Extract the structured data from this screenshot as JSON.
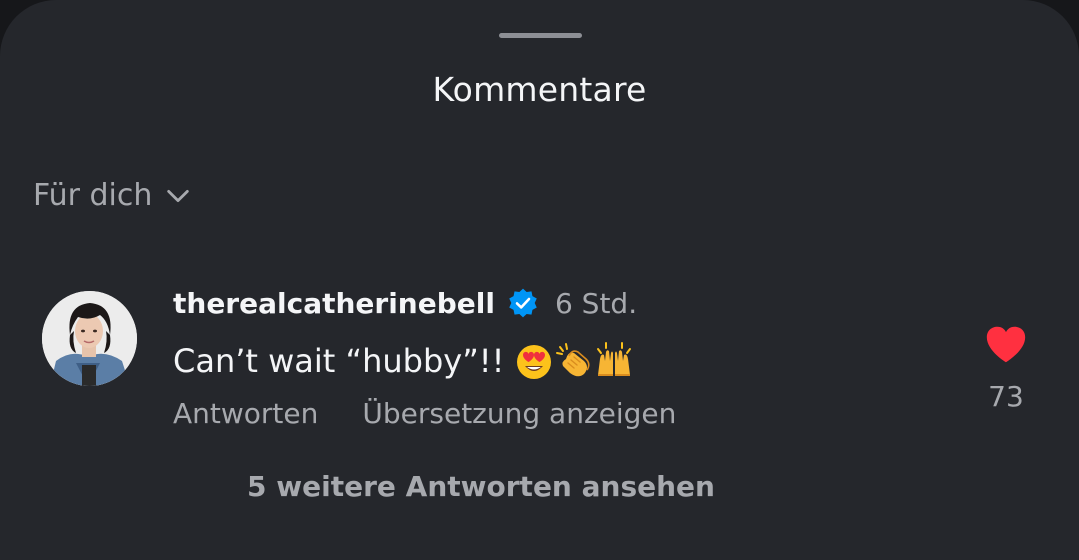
{
  "sheet": {
    "title": "Kommentare"
  },
  "filter": {
    "label": "Für dich",
    "icon": "chevron-down-icon"
  },
  "comment": {
    "username": "therealcatherinebell",
    "verified_icon": "verified-badge-icon",
    "time": "6 Std.",
    "text": "Can’t wait “hubby”!!",
    "emojis": [
      "heart-eyes-emoji",
      "clapping-hands-emoji",
      "raising-hands-emoji"
    ],
    "reply_label": "Antworten",
    "translate_label": "Übersetzung anzeigen",
    "like_icon": "heart-icon",
    "like_color": "#ff3040",
    "like_count": "73",
    "more_replies_label": "5 weitere Antworten ansehen"
  },
  "colors": {
    "sheet_background": "#25272c",
    "primary_text": "#f4f5f7",
    "secondary_text": "#a7a9ae",
    "verified_blue": "#0095f6"
  }
}
